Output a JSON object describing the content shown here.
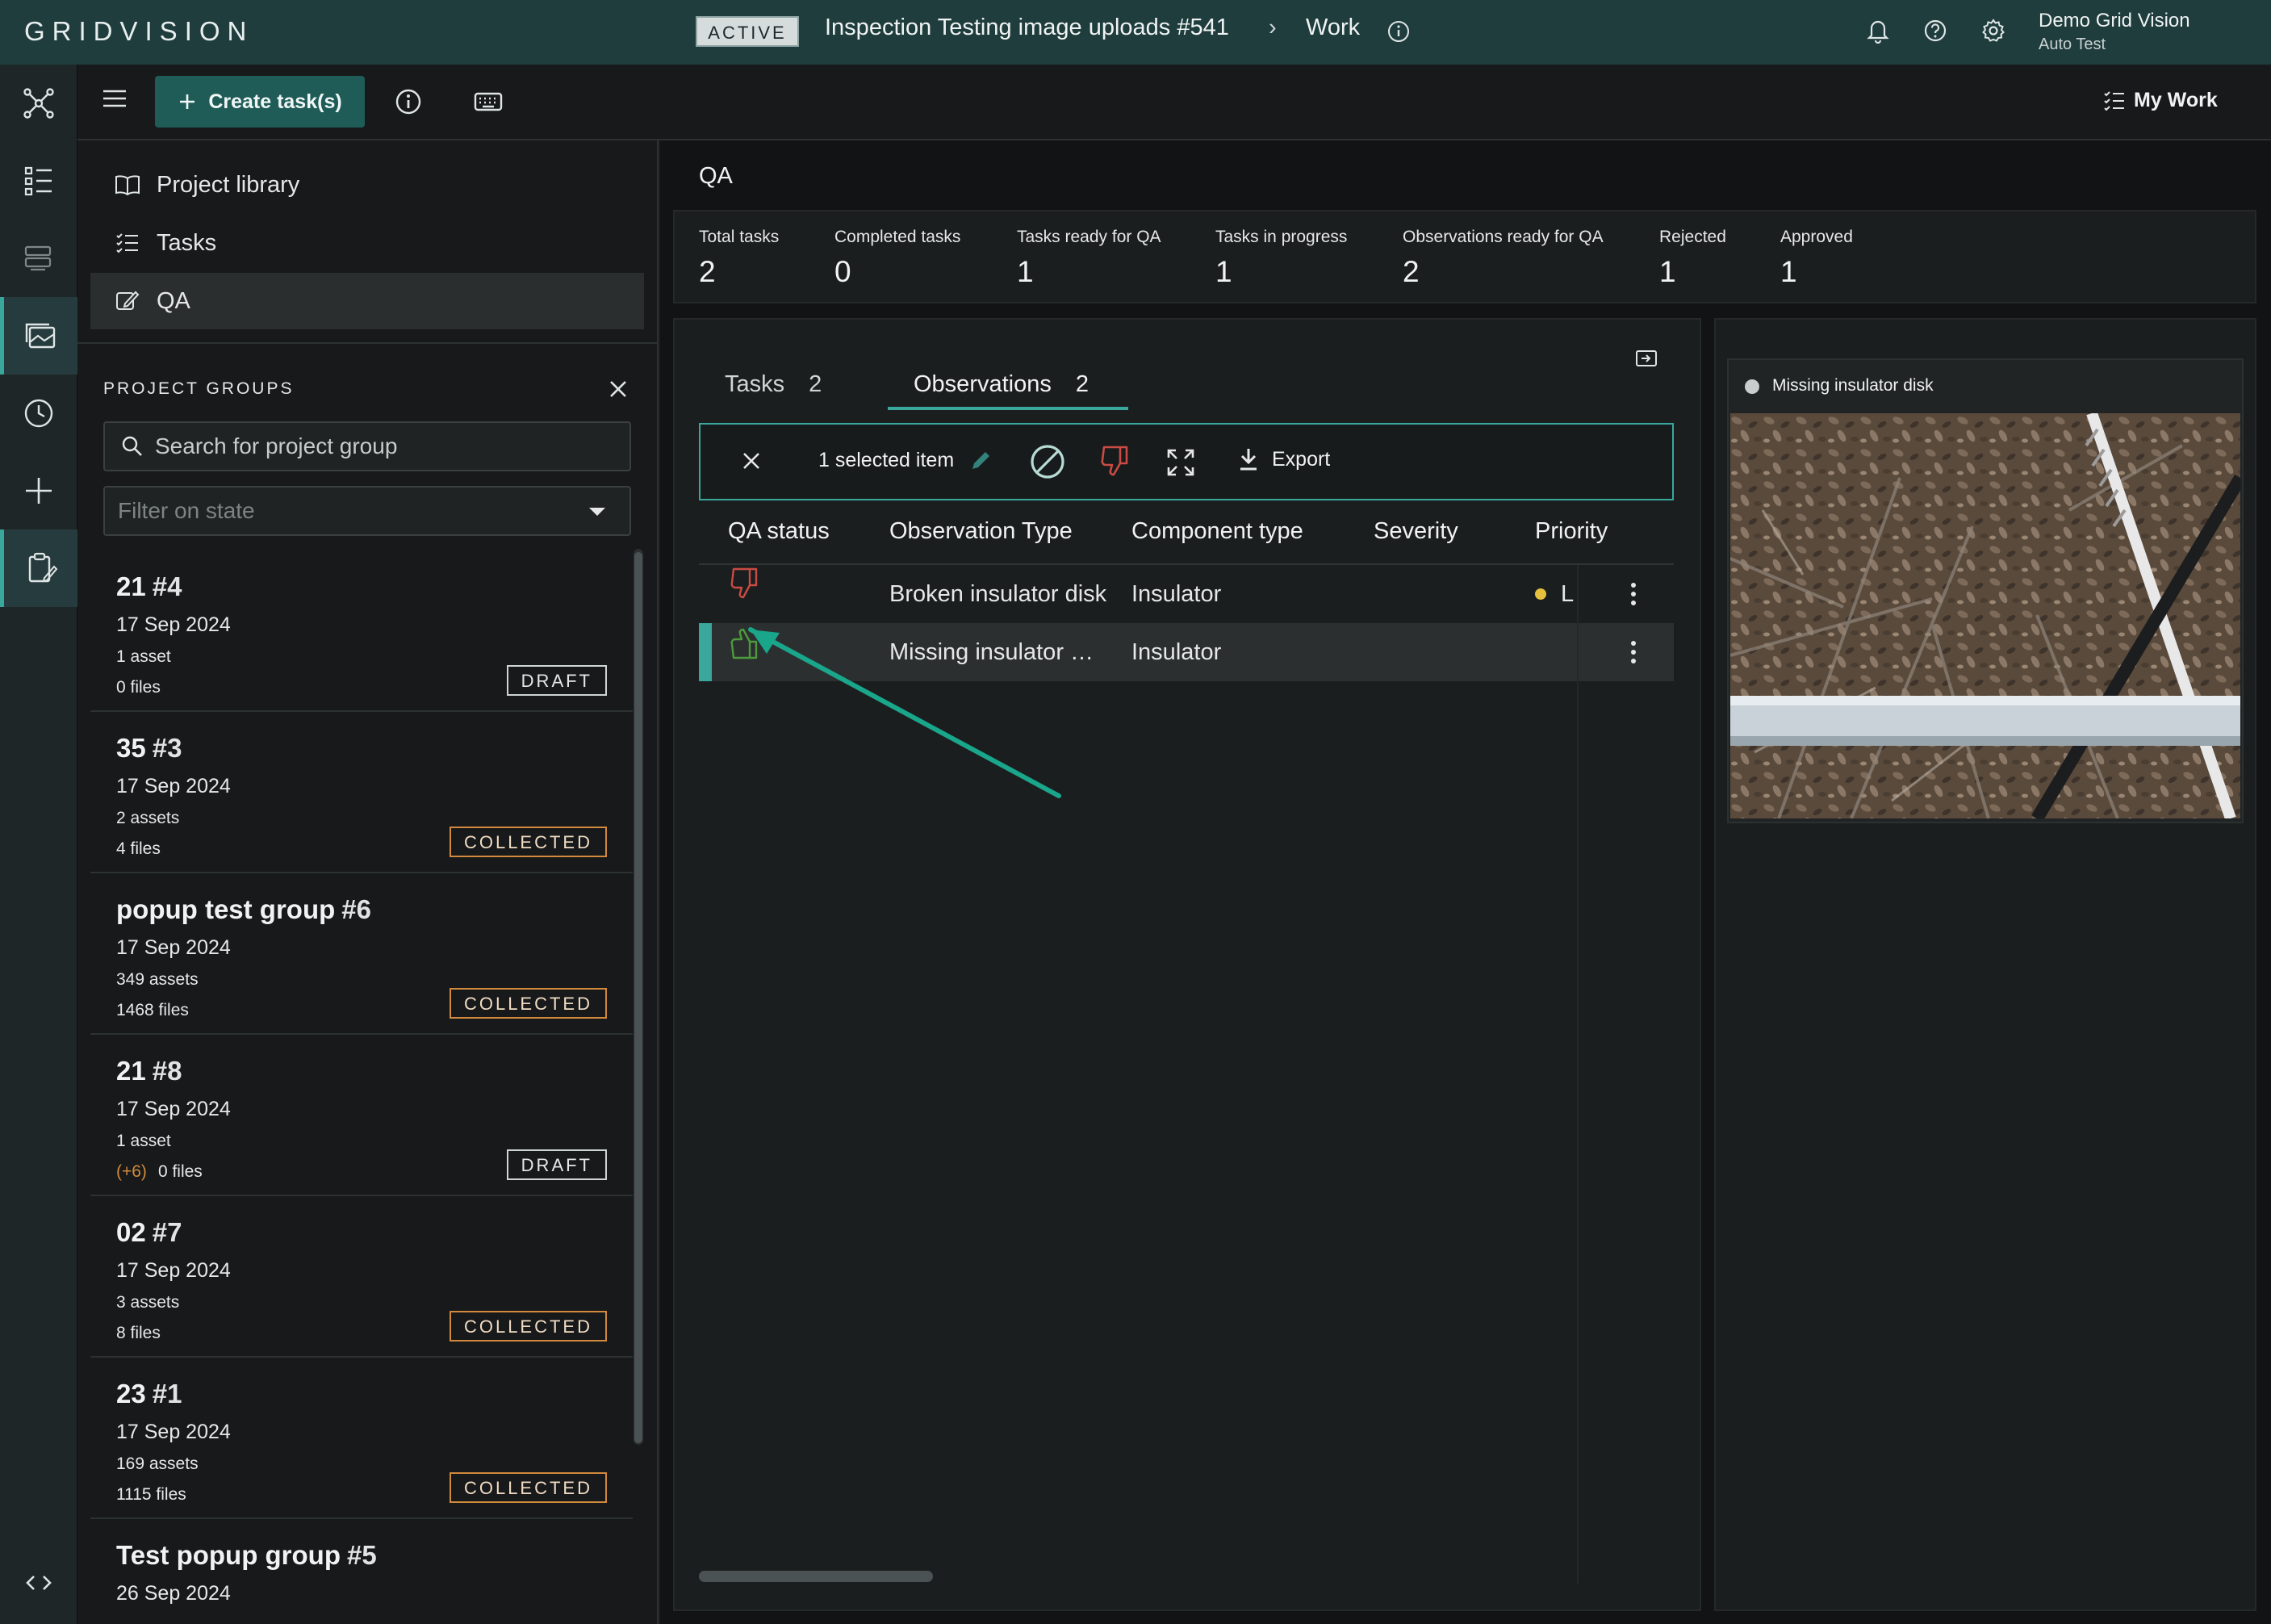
{
  "app": {
    "logo": "GRIDVISION",
    "status": "ACTIVE",
    "project_title": "Inspection Testing image uploads  #541",
    "breadcrumb_sep": "›",
    "breadcrumb_current": "Work",
    "user_name": "Demo Grid Vision",
    "user_org": "Auto Test"
  },
  "toolbar": {
    "create_label": "Create task(s)",
    "my_work_label": "My Work"
  },
  "nav": {
    "items": [
      {
        "label": "Project library",
        "icon": "book-icon"
      },
      {
        "label": "Tasks",
        "icon": "list-icon"
      },
      {
        "label": "QA",
        "icon": "edit-icon"
      }
    ]
  },
  "groups": {
    "title": "PROJECT GROUPS",
    "search_placeholder": "Search for project group",
    "filter_placeholder": "Filter on state",
    "items": [
      {
        "name": "21",
        "num": "#4",
        "date": "17 Sep 2024",
        "assets": "1 asset",
        "extra": "",
        "files": "0 files",
        "badge": "DRAFT"
      },
      {
        "name": "35",
        "num": "#3",
        "date": "17 Sep 2024",
        "assets": "2 assets",
        "extra": "",
        "files": "4 files",
        "badge": "COLLECTED"
      },
      {
        "name": "popup test group",
        "num": "#6",
        "date": "17 Sep 2024",
        "assets": "349 assets",
        "extra": "",
        "files": "1468 files",
        "badge": "COLLECTED"
      },
      {
        "name": "21",
        "num": "#8",
        "date": "17 Sep 2024",
        "assets": "1 asset",
        "extra": "(+6)",
        "files": "0 files",
        "badge": "DRAFT"
      },
      {
        "name": "02",
        "num": "#7",
        "date": "17 Sep 2024",
        "assets": "3 assets",
        "extra": "",
        "files": "8 files",
        "badge": "COLLECTED"
      },
      {
        "name": "23",
        "num": "#1",
        "date": "17 Sep 2024",
        "assets": "169 assets",
        "extra": "",
        "files": "1115 files",
        "badge": "COLLECTED"
      },
      {
        "name": "Test popup group",
        "num": "#5",
        "date": "26 Sep 2024",
        "assets": "",
        "extra": "",
        "files": "",
        "badge": ""
      }
    ]
  },
  "main": {
    "heading": "QA",
    "stats": [
      {
        "label": "Total tasks",
        "value": "2"
      },
      {
        "label": "Completed tasks",
        "value": "0"
      },
      {
        "label": "Tasks ready for QA",
        "value": "1"
      },
      {
        "label": "Tasks in progress",
        "value": "1"
      },
      {
        "label": "Observations ready for QA",
        "value": "2"
      },
      {
        "label": "Rejected",
        "value": "1"
      },
      {
        "label": "Approved",
        "value": "1"
      }
    ],
    "tabs": [
      {
        "label": "Tasks",
        "count": "2"
      },
      {
        "label": "Observations",
        "count": "2"
      }
    ],
    "action_bar": {
      "selected_text": "1 selected item",
      "export_label": "Export"
    },
    "table": {
      "columns": [
        "QA status",
        "Observation Type",
        "Component type",
        "Severity",
        "Priority"
      ],
      "rows": [
        {
          "qa_status": "rejected",
          "observation_type": "Broken insulator disk",
          "component_type": "Insulator",
          "severity": "",
          "priority": "L",
          "priority_color": "#e6c13d"
        },
        {
          "qa_status": "approved",
          "observation_type": "Missing insulator …",
          "component_type": "Insulator",
          "severity": "",
          "priority": ""
        }
      ]
    }
  },
  "preview": {
    "label": "Missing insulator disk"
  },
  "colors": {
    "accent": "#3aa79c",
    "topbar": "#1f3d3d",
    "rejected": "#c94b43",
    "approved": "#4d9a3c",
    "collected_badge": "#d28a3c"
  }
}
